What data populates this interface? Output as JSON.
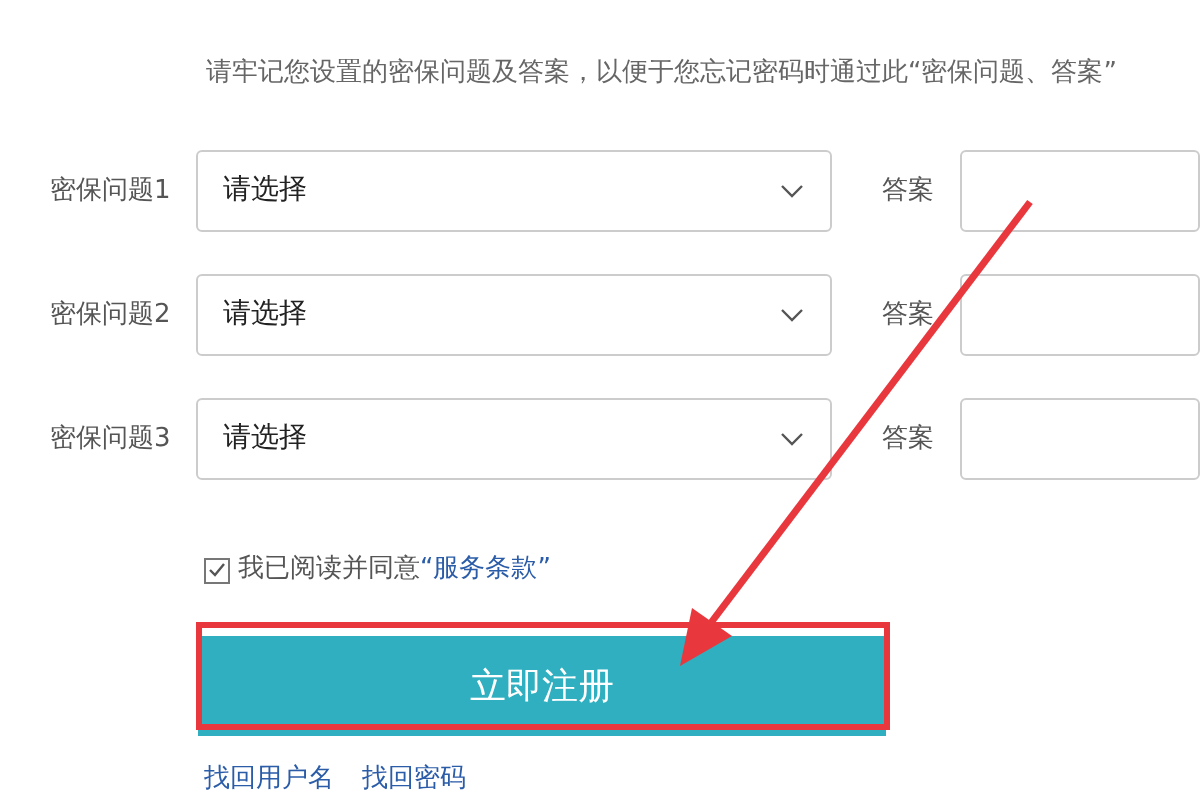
{
  "notice": "请牢记您设置的密保问题及答案，以便于您忘记密码时通过此“密保问题、答案”",
  "questions": [
    {
      "label": "密保问题1",
      "select": {
        "value": "请选择"
      },
      "answer_label": "答案"
    },
    {
      "label": "密保问题2",
      "select": {
        "value": "请选择"
      },
      "answer_label": "答案"
    },
    {
      "label": "密保问题3",
      "select": {
        "value": "请选择"
      },
      "answer_label": "答案"
    }
  ],
  "agreement": {
    "checked": true,
    "text": "我已阅读并同意",
    "link": "“服务条款”"
  },
  "submit_button": "立即注册",
  "links": [
    "找回用户名",
    "找回密码"
  ]
}
